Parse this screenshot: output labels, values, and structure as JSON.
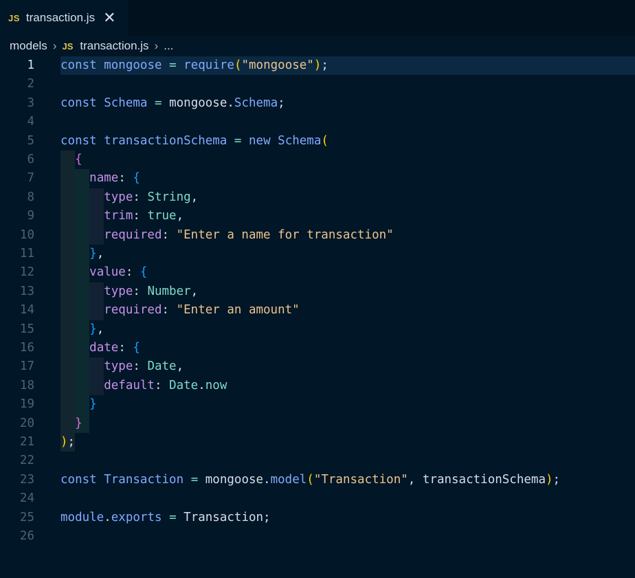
{
  "tab": {
    "icon": "JS",
    "label": "transaction.js",
    "close": "✕"
  },
  "breadcrumb": {
    "folder": "models",
    "icon": "JS",
    "file": "transaction.js",
    "more": "..."
  },
  "lines": [
    {
      "n": "1",
      "active": true,
      "tokens": [
        [
          "kw",
          "const"
        ],
        [
          "plain",
          " "
        ],
        [
          "var",
          "mongoose"
        ],
        [
          "plain",
          " "
        ],
        [
          "op",
          "="
        ],
        [
          "plain",
          " "
        ],
        [
          "fn",
          "require"
        ],
        [
          "b1",
          "("
        ],
        [
          "str",
          "\"mongoose\""
        ],
        [
          "b1",
          ")"
        ],
        [
          "plain",
          ";"
        ]
      ]
    },
    {
      "n": "2",
      "tokens": []
    },
    {
      "n": "3",
      "tokens": [
        [
          "kw",
          "const"
        ],
        [
          "plain",
          " "
        ],
        [
          "var",
          "Schema"
        ],
        [
          "plain",
          " "
        ],
        [
          "op",
          "="
        ],
        [
          "plain",
          " mongoose."
        ],
        [
          "var",
          "Schema"
        ],
        [
          "plain",
          ";"
        ]
      ]
    },
    {
      "n": "4",
      "tokens": []
    },
    {
      "n": "5",
      "tokens": [
        [
          "kw",
          "const"
        ],
        [
          "plain",
          " "
        ],
        [
          "var",
          "transactionSchema"
        ],
        [
          "plain",
          " "
        ],
        [
          "op",
          "="
        ],
        [
          "plain",
          " "
        ],
        [
          "kw",
          "new"
        ],
        [
          "plain",
          " "
        ],
        [
          "var",
          "Schema"
        ],
        [
          "b1",
          "("
        ]
      ]
    },
    {
      "n": "6",
      "tokens": [
        [
          "plain",
          "  "
        ],
        [
          "b2",
          "{"
        ]
      ]
    },
    {
      "n": "7",
      "tokens": [
        [
          "plain",
          "    "
        ],
        [
          "prop",
          "name"
        ],
        [
          "plain",
          ": "
        ],
        [
          "b3",
          "{"
        ]
      ]
    },
    {
      "n": "8",
      "tokens": [
        [
          "plain",
          "      "
        ],
        [
          "prop",
          "type"
        ],
        [
          "plain",
          ": "
        ],
        [
          "type",
          "String"
        ],
        [
          "plain",
          ","
        ]
      ]
    },
    {
      "n": "9",
      "tokens": [
        [
          "plain",
          "      "
        ],
        [
          "prop",
          "trim"
        ],
        [
          "plain",
          ": "
        ],
        [
          "type",
          "true"
        ],
        [
          "plain",
          ","
        ]
      ]
    },
    {
      "n": "10",
      "tokens": [
        [
          "plain",
          "      "
        ],
        [
          "prop",
          "required"
        ],
        [
          "plain",
          ": "
        ],
        [
          "str",
          "\"Enter a name for transaction\""
        ]
      ]
    },
    {
      "n": "11",
      "tokens": [
        [
          "plain",
          "    "
        ],
        [
          "b3",
          "}"
        ],
        [
          "plain",
          ","
        ]
      ]
    },
    {
      "n": "12",
      "tokens": [
        [
          "plain",
          "    "
        ],
        [
          "prop",
          "value"
        ],
        [
          "plain",
          ": "
        ],
        [
          "b3",
          "{"
        ]
      ]
    },
    {
      "n": "13",
      "tokens": [
        [
          "plain",
          "      "
        ],
        [
          "prop",
          "type"
        ],
        [
          "plain",
          ": "
        ],
        [
          "type",
          "Number"
        ],
        [
          "plain",
          ","
        ]
      ]
    },
    {
      "n": "14",
      "tokens": [
        [
          "plain",
          "      "
        ],
        [
          "prop",
          "required"
        ],
        [
          "plain",
          ": "
        ],
        [
          "str",
          "\"Enter an amount\""
        ]
      ]
    },
    {
      "n": "15",
      "tokens": [
        [
          "plain",
          "    "
        ],
        [
          "b3",
          "}"
        ],
        [
          "plain",
          ","
        ]
      ]
    },
    {
      "n": "16",
      "tokens": [
        [
          "plain",
          "    "
        ],
        [
          "prop",
          "date"
        ],
        [
          "plain",
          ": "
        ],
        [
          "b3",
          "{"
        ]
      ]
    },
    {
      "n": "17",
      "tokens": [
        [
          "plain",
          "      "
        ],
        [
          "prop",
          "type"
        ],
        [
          "plain",
          ": "
        ],
        [
          "type",
          "Date"
        ],
        [
          "plain",
          ","
        ]
      ]
    },
    {
      "n": "18",
      "tokens": [
        [
          "plain",
          "      "
        ],
        [
          "prop",
          "default"
        ],
        [
          "plain",
          ": "
        ],
        [
          "type",
          "Date"
        ],
        [
          "plain",
          "."
        ],
        [
          "type",
          "now"
        ]
      ]
    },
    {
      "n": "19",
      "tokens": [
        [
          "plain",
          "    "
        ],
        [
          "b3",
          "}"
        ]
      ]
    },
    {
      "n": "20",
      "tokens": [
        [
          "plain",
          "  "
        ],
        [
          "b2",
          "}"
        ]
      ]
    },
    {
      "n": "21",
      "tokens": [
        [
          "b1",
          ")"
        ],
        [
          "plain",
          ";"
        ]
      ]
    },
    {
      "n": "22",
      "tokens": []
    },
    {
      "n": "23",
      "tokens": [
        [
          "kw",
          "const"
        ],
        [
          "plain",
          " "
        ],
        [
          "var",
          "Transaction"
        ],
        [
          "plain",
          " "
        ],
        [
          "op",
          "="
        ],
        [
          "plain",
          " mongoose."
        ],
        [
          "fn",
          "model"
        ],
        [
          "b1",
          "("
        ],
        [
          "str",
          "\"Transaction\""
        ],
        [
          "plain",
          ", transactionSchema"
        ],
        [
          "b1",
          ")"
        ],
        [
          "plain",
          ";"
        ]
      ]
    },
    {
      "n": "24",
      "tokens": []
    },
    {
      "n": "25",
      "tokens": [
        [
          "var",
          "module"
        ],
        [
          "plain",
          "."
        ],
        [
          "var",
          "exports"
        ],
        [
          "plain",
          " "
        ],
        [
          "op",
          "="
        ],
        [
          "plain",
          " Transaction;"
        ]
      ]
    },
    {
      "n": "26",
      "tokens": []
    }
  ],
  "colors": {
    "background": "#011627",
    "active_line": "#0b2942",
    "keyword": "#82aaff",
    "string": "#ecc48d",
    "property": "#c792ea",
    "type": "#7fdbca"
  }
}
